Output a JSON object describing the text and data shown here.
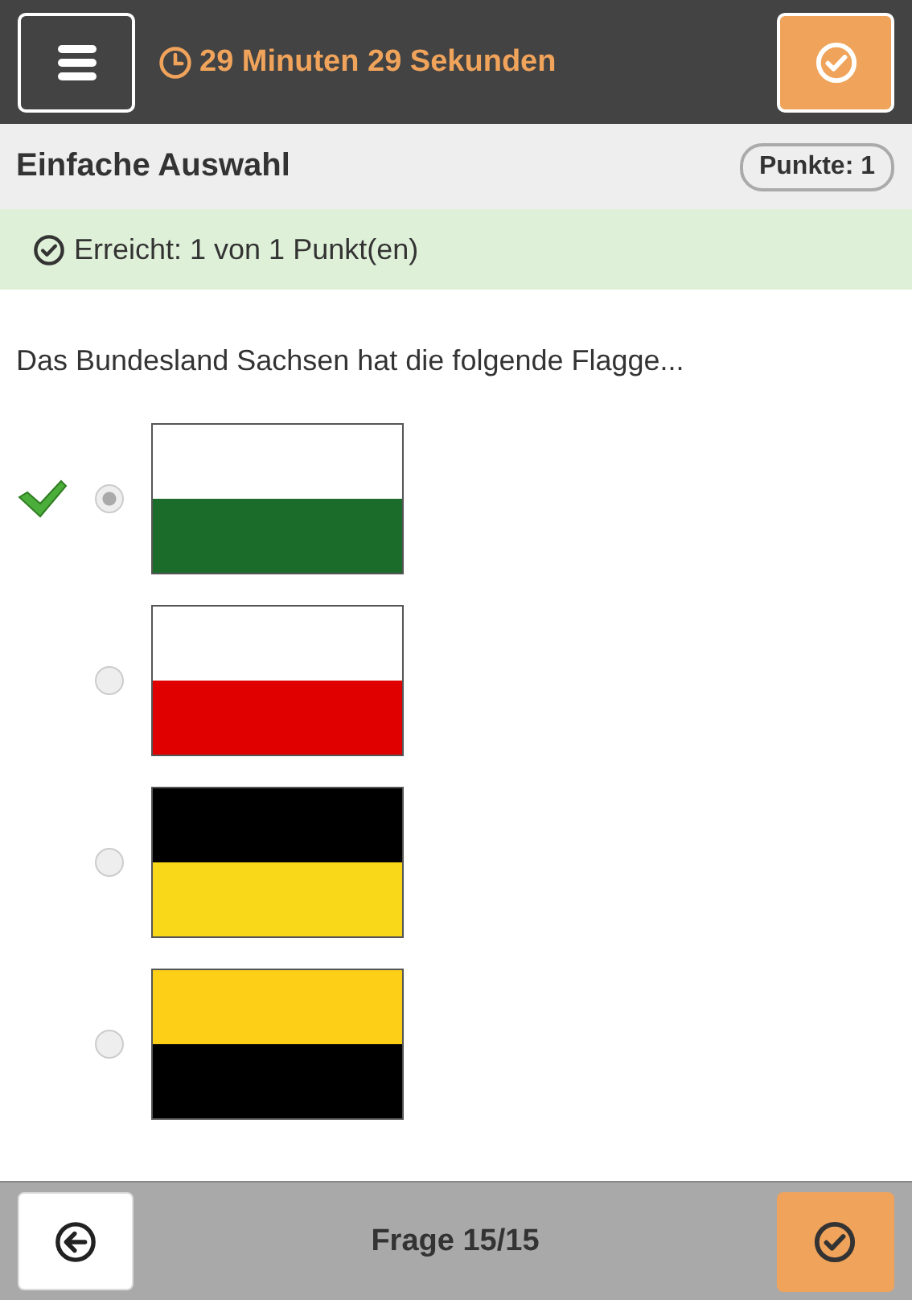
{
  "header": {
    "timer": "29 Minuten 29 Sekunden"
  },
  "question": {
    "type": "Einfache Auswahl",
    "points": "Punkte: 1",
    "result": "Erreicht: 1 von 1 Punkt(en)",
    "text": "Das Bundesland Sachsen hat die folgende Flagge..."
  },
  "options": [
    {
      "selected": true,
      "correct": true,
      "stripes": [
        {
          "color": "#ffffff"
        },
        {
          "color": "#1b6b2a"
        }
      ]
    },
    {
      "selected": false,
      "correct": false,
      "stripes": [
        {
          "color": "#ffffff"
        },
        {
          "color": "#e00000"
        }
      ]
    },
    {
      "selected": false,
      "correct": false,
      "stripes": [
        {
          "color": "#000000"
        },
        {
          "color": "#f8d818"
        }
      ]
    },
    {
      "selected": false,
      "correct": false,
      "stripes": [
        {
          "color": "#fdd017"
        },
        {
          "color": "#000000"
        }
      ]
    }
  ],
  "footer": {
    "label": "Frage 15/15"
  }
}
